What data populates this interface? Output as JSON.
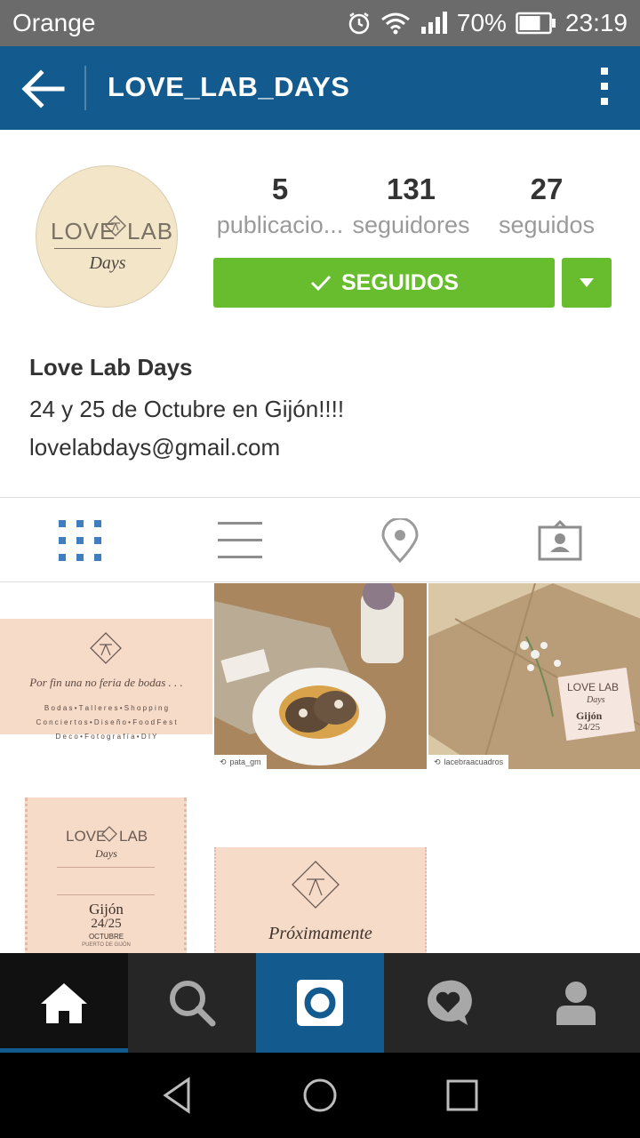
{
  "status_bar": {
    "carrier": "Orange",
    "battery": "70%",
    "time": "23:19",
    "icons": [
      "alarm-icon",
      "wifi-icon",
      "signal-icon",
      "battery-icon"
    ]
  },
  "app_bar": {
    "title": "LOVE_LAB_DAYS",
    "back_icon": "arrow-left-icon",
    "menu_icon": "more-vertical-icon"
  },
  "profile": {
    "avatar_logo": {
      "left": "LOVE",
      "right": "LAB",
      "sub": "Days"
    },
    "stats": [
      {
        "value": "5",
        "label": "publicacio..."
      },
      {
        "value": "131",
        "label": "seguidores"
      },
      {
        "value": "27",
        "label": "seguidos"
      }
    ],
    "follow_button": "SEGUIDOS",
    "name": "Love Lab Days",
    "bio_line": "24 y 25 de Octubre en Gijón!!!!",
    "email": "lovelabdays@gmail.com"
  },
  "tabs": [
    {
      "icon": "grid-icon",
      "active": true
    },
    {
      "icon": "list-icon",
      "active": false
    },
    {
      "icon": "location-pin-icon",
      "active": false
    },
    {
      "icon": "tagged-photos-icon",
      "active": false
    }
  ],
  "grid": {
    "post1": {
      "script": "Por fin una no feria de bodas . . .",
      "line1": "B o d a s  •  T a l l e r e s  •  S h o p p i n g",
      "line2": "C o n c i e r t o s  •  D i s e ñ o  •  F o o d F e s t",
      "line3": "D e c o  •  F o t o g r a f í a  •  D I Y"
    },
    "post2": {
      "repost_user": "pata_gm"
    },
    "post3": {
      "repost_user": "lacebraacuadros",
      "card_logo": "LOVE LAB",
      "card_sub": "Days",
      "card_city": "Gijón",
      "card_date": "24/25"
    },
    "post4": {
      "logo_left": "LOVE",
      "logo_right": "LAB",
      "logo_sub": "Days",
      "city": "Gijón",
      "date": "24/25",
      "month": "OCTUBRE",
      "place": "PUERTO DE GIJÓN"
    },
    "post5": {
      "script": "Próximamente"
    }
  },
  "bottom_nav": [
    {
      "icon": "home-icon"
    },
    {
      "icon": "search-icon"
    },
    {
      "icon": "camera-icon"
    },
    {
      "icon": "activity-heart-icon"
    },
    {
      "icon": "profile-icon"
    }
  ],
  "system_nav": [
    "back-triangle-icon",
    "home-circle-icon",
    "recents-square-icon"
  ],
  "colors": {
    "app_bar": "#135a8e",
    "follow_green": "#68bd2e",
    "active_tab": "#3f7fc0"
  }
}
